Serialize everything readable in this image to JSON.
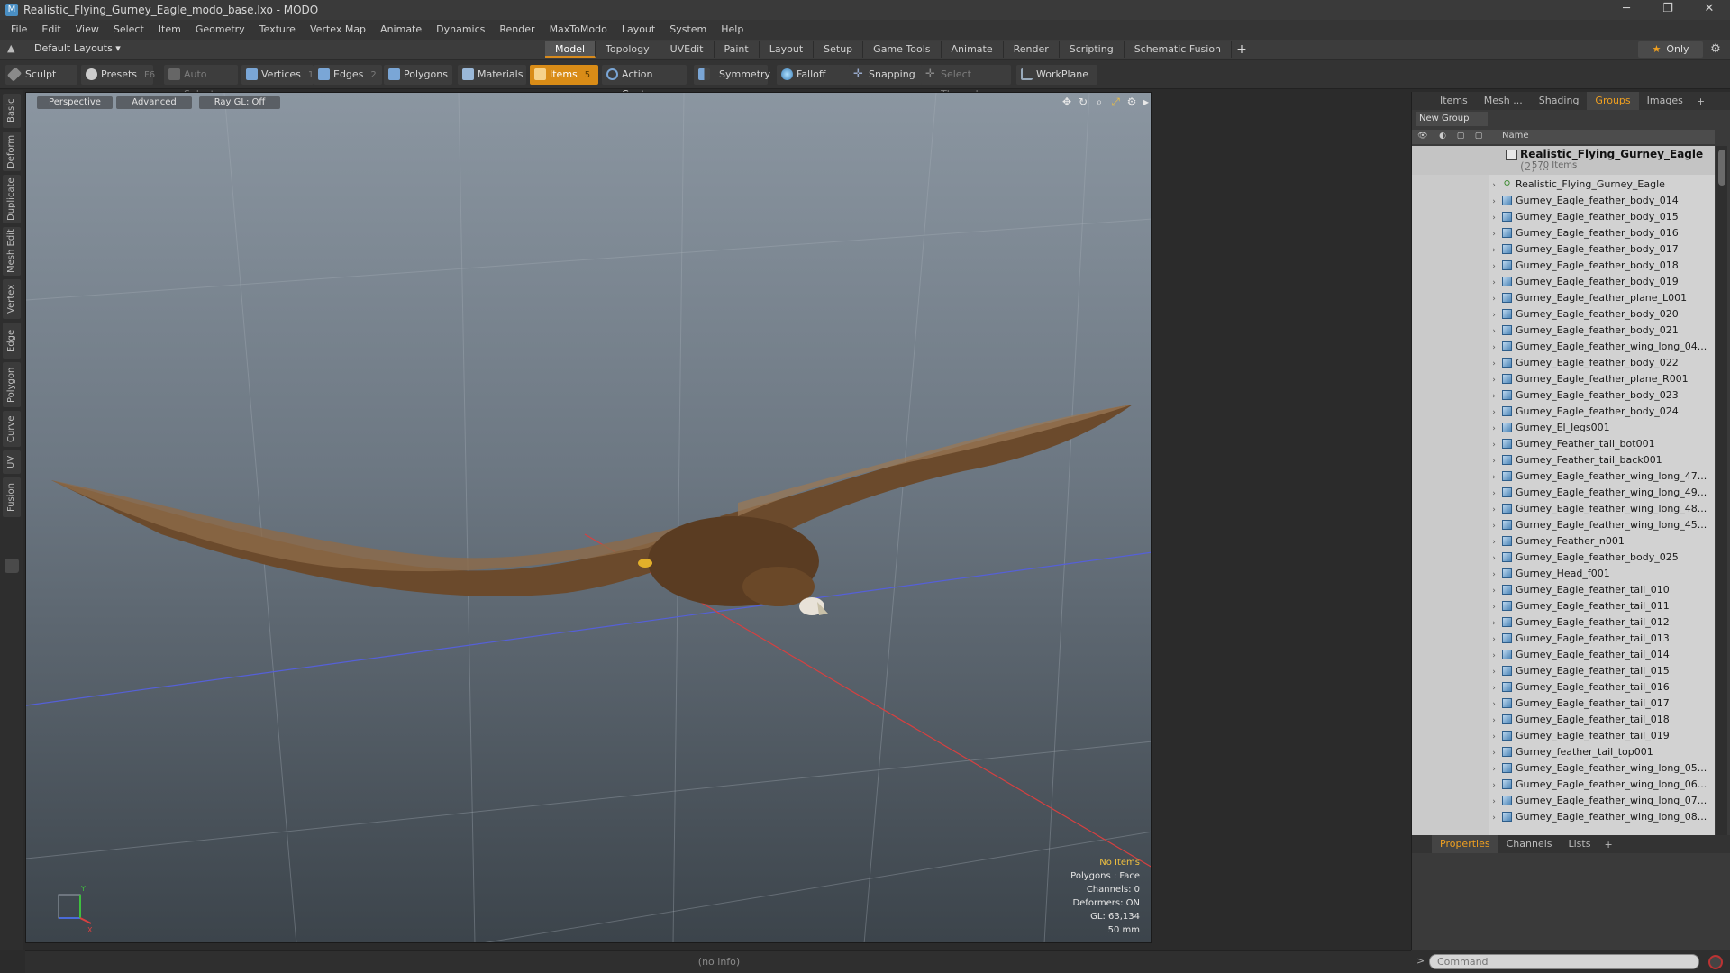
{
  "window": {
    "title": "Realistic_Flying_Gurney_Eagle_modo_base.lxo - MODO",
    "minimize": "─",
    "restore": "❐",
    "close": "✕"
  },
  "menu": [
    "File",
    "Edit",
    "View",
    "Select",
    "Item",
    "Geometry",
    "Texture",
    "Vertex Map",
    "Animate",
    "Dynamics",
    "Render",
    "MaxToModo",
    "Layout",
    "System",
    "Help"
  ],
  "layoutbar": {
    "layouts_dropdown": "Default Layouts ▾",
    "tabs": [
      "Model",
      "Topology",
      "UVEdit",
      "Paint",
      "Layout",
      "Setup",
      "Game Tools",
      "Animate",
      "Render",
      "Scripting",
      "Schematic Fusion"
    ],
    "active_tab": "Model",
    "plus": "+",
    "only_label": "Only",
    "star": "★",
    "gear": "⚙"
  },
  "toolbar": {
    "sculpt": "Sculpt",
    "presets": "Presets",
    "presets_key": "F6",
    "auto_select": "Auto Select",
    "vertices": "Vertices",
    "vertices_key": "1",
    "edges": "Edges",
    "edges_key": "2",
    "polygons": "Polygons",
    "materials": "Materials",
    "items": "Items",
    "items_key": "5",
    "action_center": "Action Center",
    "symmetry": "Symmetry",
    "falloff": "Falloff",
    "snapping": "Snapping",
    "select_through": "Select Through",
    "workplane": "WorkPlane"
  },
  "left_tabs": [
    "Basic",
    "Deform",
    "Duplicate",
    "Mesh Edit",
    "Vertex",
    "Edge",
    "Polygon",
    "Curve",
    "UV",
    "Fusion"
  ],
  "viewport": {
    "perspective": "Perspective",
    "advanced": "Advanced",
    "raygl": "Ray GL: Off",
    "info": {
      "no_items": "No Items",
      "polygons": "Polygons : Face",
      "channels": "Channels: 0",
      "deformers": "Deformers: ON",
      "gl": "GL: 63,134",
      "focal": "50 mm"
    },
    "axis_labels": {
      "y": "Y",
      "x": "X"
    }
  },
  "status": {
    "info": "(no info)"
  },
  "panel_tabs": [
    "Items",
    "Mesh ...",
    "Shading",
    "Groups",
    "Images"
  ],
  "panel_active_tab": "Groups",
  "panel_plus": "+",
  "new_group": "New Group",
  "list_header": {
    "name": "Name"
  },
  "group": {
    "name": "Realistic_Flying_Gurney_Eagle",
    "count": "(2) ...",
    "items_count": "570 Items"
  },
  "items": [
    {
      "name": "Realistic_Flying_Gurney_Eagle",
      "type": "locator"
    },
    {
      "name": "Gurney_Eagle_feather_body_014",
      "type": "mesh"
    },
    {
      "name": "Gurney_Eagle_feather_body_015",
      "type": "mesh"
    },
    {
      "name": "Gurney_Eagle_feather_body_016",
      "type": "mesh"
    },
    {
      "name": "Gurney_Eagle_feather_body_017",
      "type": "mesh"
    },
    {
      "name": "Gurney_Eagle_feather_body_018",
      "type": "mesh"
    },
    {
      "name": "Gurney_Eagle_feather_body_019",
      "type": "mesh"
    },
    {
      "name": "Gurney_Eagle_feather_plane_L001",
      "type": "mesh"
    },
    {
      "name": "Gurney_Eagle_feather_body_020",
      "type": "mesh"
    },
    {
      "name": "Gurney_Eagle_feather_body_021",
      "type": "mesh"
    },
    {
      "name": "Gurney_Eagle_feather_wing_long_04...",
      "type": "mesh"
    },
    {
      "name": "Gurney_Eagle_feather_body_022",
      "type": "mesh"
    },
    {
      "name": "Gurney_Eagle_feather_plane_R001",
      "type": "mesh"
    },
    {
      "name": "Gurney_Eagle_feather_body_023",
      "type": "mesh"
    },
    {
      "name": "Gurney_Eagle_feather_body_024",
      "type": "mesh"
    },
    {
      "name": "Gurney_El_legs001",
      "type": "mesh"
    },
    {
      "name": "Gurney_Feather_tail_bot001",
      "type": "mesh"
    },
    {
      "name": "Gurney_Feather_tail_back001",
      "type": "mesh"
    },
    {
      "name": "Gurney_Eagle_feather_wing_long_47...",
      "type": "mesh"
    },
    {
      "name": "Gurney_Eagle_feather_wing_long_49...",
      "type": "mesh"
    },
    {
      "name": "Gurney_Eagle_feather_wing_long_48...",
      "type": "mesh"
    },
    {
      "name": "Gurney_Eagle_feather_wing_long_45...",
      "type": "mesh"
    },
    {
      "name": "Gurney_Feather_n001",
      "type": "mesh"
    },
    {
      "name": "Gurney_Eagle_feather_body_025",
      "type": "mesh"
    },
    {
      "name": "Gurney_Head_f001",
      "type": "mesh"
    },
    {
      "name": "Gurney_Eagle_feather_tail_010",
      "type": "mesh"
    },
    {
      "name": "Gurney_Eagle_feather_tail_011",
      "type": "mesh"
    },
    {
      "name": "Gurney_Eagle_feather_tail_012",
      "type": "mesh"
    },
    {
      "name": "Gurney_Eagle_feather_tail_013",
      "type": "mesh"
    },
    {
      "name": "Gurney_Eagle_feather_tail_014",
      "type": "mesh"
    },
    {
      "name": "Gurney_Eagle_feather_tail_015",
      "type": "mesh"
    },
    {
      "name": "Gurney_Eagle_feather_tail_016",
      "type": "mesh"
    },
    {
      "name": "Gurney_Eagle_feather_tail_017",
      "type": "mesh"
    },
    {
      "name": "Gurney_Eagle_feather_tail_018",
      "type": "mesh"
    },
    {
      "name": "Gurney_Eagle_feather_tail_019",
      "type": "mesh"
    },
    {
      "name": "Gurney_feather_tail_top001",
      "type": "mesh"
    },
    {
      "name": "Gurney_Eagle_feather_wing_long_05...",
      "type": "mesh"
    },
    {
      "name": "Gurney_Eagle_feather_wing_long_06...",
      "type": "mesh"
    },
    {
      "name": "Gurney_Eagle_feather_wing_long_07...",
      "type": "mesh"
    },
    {
      "name": "Gurney_Eagle_feather_wing_long_08...",
      "type": "mesh"
    }
  ],
  "props_tabs": [
    "Properties",
    "Channels",
    "Lists"
  ],
  "props_active_tab": "Properties",
  "command": {
    "placeholder": "Command",
    "prompt": ">"
  },
  "colors": {
    "accent": "#d98c17",
    "viewport_top": "#8b96a1",
    "viewport_bottom": "#3c444b"
  }
}
